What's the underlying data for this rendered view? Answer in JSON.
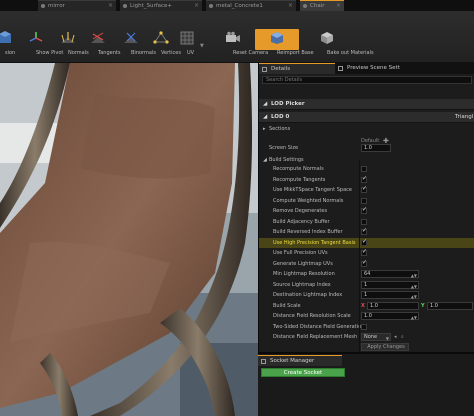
{
  "tabs": [
    {
      "label": "mirror",
      "active": false
    },
    {
      "label": "Light_Surface+",
      "active": false
    },
    {
      "label": "metal_Concrete1",
      "active": false
    },
    {
      "label": "Chair",
      "active": true
    }
  ],
  "toolbar": {
    "items": [
      {
        "label": "sion",
        "icon": "tangent-display-icon"
      },
      {
        "label": "Show Pivot",
        "icon": "pivot-icon"
      },
      {
        "label": "Normals",
        "icon": "normals-icon"
      },
      {
        "label": "Tangents",
        "icon": "tangents-icon"
      },
      {
        "label": "Binormals",
        "icon": "binormals-icon"
      },
      {
        "label": "Vertices",
        "icon": "vertices-icon"
      },
      {
        "label": "UV",
        "icon": "uv-grid-icon"
      },
      {
        "label": "Reset Camera",
        "icon": "camera-icon"
      },
      {
        "label": "Reimport Base",
        "icon": "reimport-icon",
        "active": true
      },
      {
        "label": "Bake out Materials",
        "icon": "bake-icon"
      }
    ]
  },
  "panel": {
    "tabs": [
      "Details",
      "Preview Scene Sett"
    ],
    "search_placeholder": "Search Details",
    "lod_picker": "LOD Picker",
    "lod0": "LOD 0",
    "lod0_right": "Triangl",
    "sections": "Sections",
    "screen_size_label": "Screen Size",
    "screen_size_default": "Default",
    "screen_size_value": "1.0",
    "build_settings": "Build Settings",
    "checkboxes": [
      {
        "label": "Recompute Normals",
        "checked": false
      },
      {
        "label": "Recompute Tangents",
        "checked": true
      },
      {
        "label": "Use MikkTSpace Tangent Space",
        "checked": true
      },
      {
        "label": "Compute Weighted Normals",
        "checked": false
      },
      {
        "label": "Remove Degenerates",
        "checked": true
      },
      {
        "label": "Build Adjacency Buffer",
        "checked": false
      },
      {
        "label": "Build Reversed Index Buffer",
        "checked": true
      },
      {
        "label": "Use High Precision Tangent Basis",
        "checked": true,
        "highlight": true
      },
      {
        "label": "Use Full Precision UVs",
        "checked": true
      },
      {
        "label": "Generate Lightmap UVs",
        "checked": true
      }
    ],
    "numbers": [
      {
        "label": "Min Lightmap Resolution",
        "value": "64"
      },
      {
        "label": "Source Lightmap Index",
        "value": "1"
      },
      {
        "label": "Destination Lightmap Index",
        "value": "1"
      }
    ],
    "build_scale": {
      "label": "Build Scale",
      "x_label": "X",
      "x_value": "1.0",
      "y_label": "Y",
      "y_value": "1.0"
    },
    "distance_field_res": {
      "label": "Distance Field Resolution Scale",
      "value": "1.0"
    },
    "two_sided": {
      "label": "Two-Sided Distance Field Generation",
      "checked": false
    },
    "replacement_mesh": {
      "label": "Distance Field Replacement Mesh",
      "value": "None"
    },
    "apply_changes": "Apply Changes"
  },
  "socket_manager": {
    "title": "Socket Manager",
    "create_button": "Create Socket"
  },
  "colors": {
    "accent": "#e59a2a",
    "highlight_text": "#f2df3a",
    "create_button": "#4aa34a"
  }
}
